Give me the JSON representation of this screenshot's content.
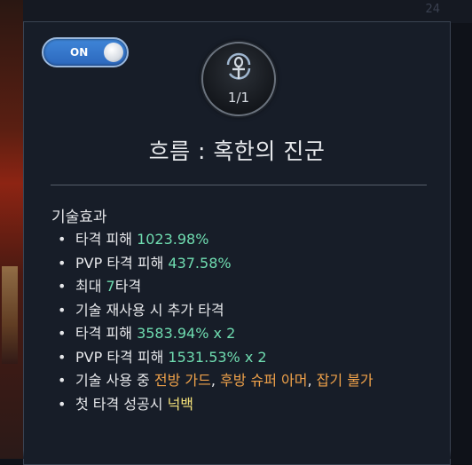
{
  "toggle": {
    "label": "ON",
    "state": "on"
  },
  "corner_number": "24",
  "skill": {
    "count": "1/1",
    "icon": "ankh-swirl-icon"
  },
  "title": "흐름 : 혹한의 진군",
  "section_title": "기술효과",
  "effects": [
    {
      "parts": [
        {
          "text": "타격 피해 ",
          "color": "default"
        },
        {
          "text": "1023.98%",
          "color": "green"
        }
      ]
    },
    {
      "parts": [
        {
          "text": "PVP 타격 피해 ",
          "color": "default"
        },
        {
          "text": "437.58%",
          "color": "green"
        }
      ]
    },
    {
      "parts": [
        {
          "text": "최대 ",
          "color": "default"
        },
        {
          "text": "7",
          "color": "green"
        },
        {
          "text": "타격",
          "color": "default"
        }
      ]
    },
    {
      "parts": [
        {
          "text": "기술 재사용 시 추가 타격",
          "color": "default"
        }
      ]
    },
    {
      "parts": [
        {
          "text": "타격 피해 ",
          "color": "default"
        },
        {
          "text": "3583.94% x 2",
          "color": "green"
        }
      ]
    },
    {
      "parts": [
        {
          "text": "PVP 타격 피해 ",
          "color": "default"
        },
        {
          "text": "1531.53% x 2",
          "color": "green"
        }
      ]
    },
    {
      "parts": [
        {
          "text": "기술 사용 중 ",
          "color": "default"
        },
        {
          "text": "전방 가드",
          "color": "orange"
        },
        {
          "text": ", ",
          "color": "default"
        },
        {
          "text": "후방 슈퍼 아머",
          "color": "orange"
        },
        {
          "text": ",  ",
          "color": "default"
        },
        {
          "text": "잡기 불가",
          "color": "orange"
        }
      ]
    },
    {
      "parts": [
        {
          "text": "첫 타격 성공시 ",
          "color": "default"
        },
        {
          "text": "넉백",
          "color": "yellow"
        }
      ]
    }
  ],
  "colors": {
    "green": "#6fdcb0",
    "orange": "#f0a24a",
    "yellow": "#f5e27a",
    "default": "#e6e7ea"
  }
}
